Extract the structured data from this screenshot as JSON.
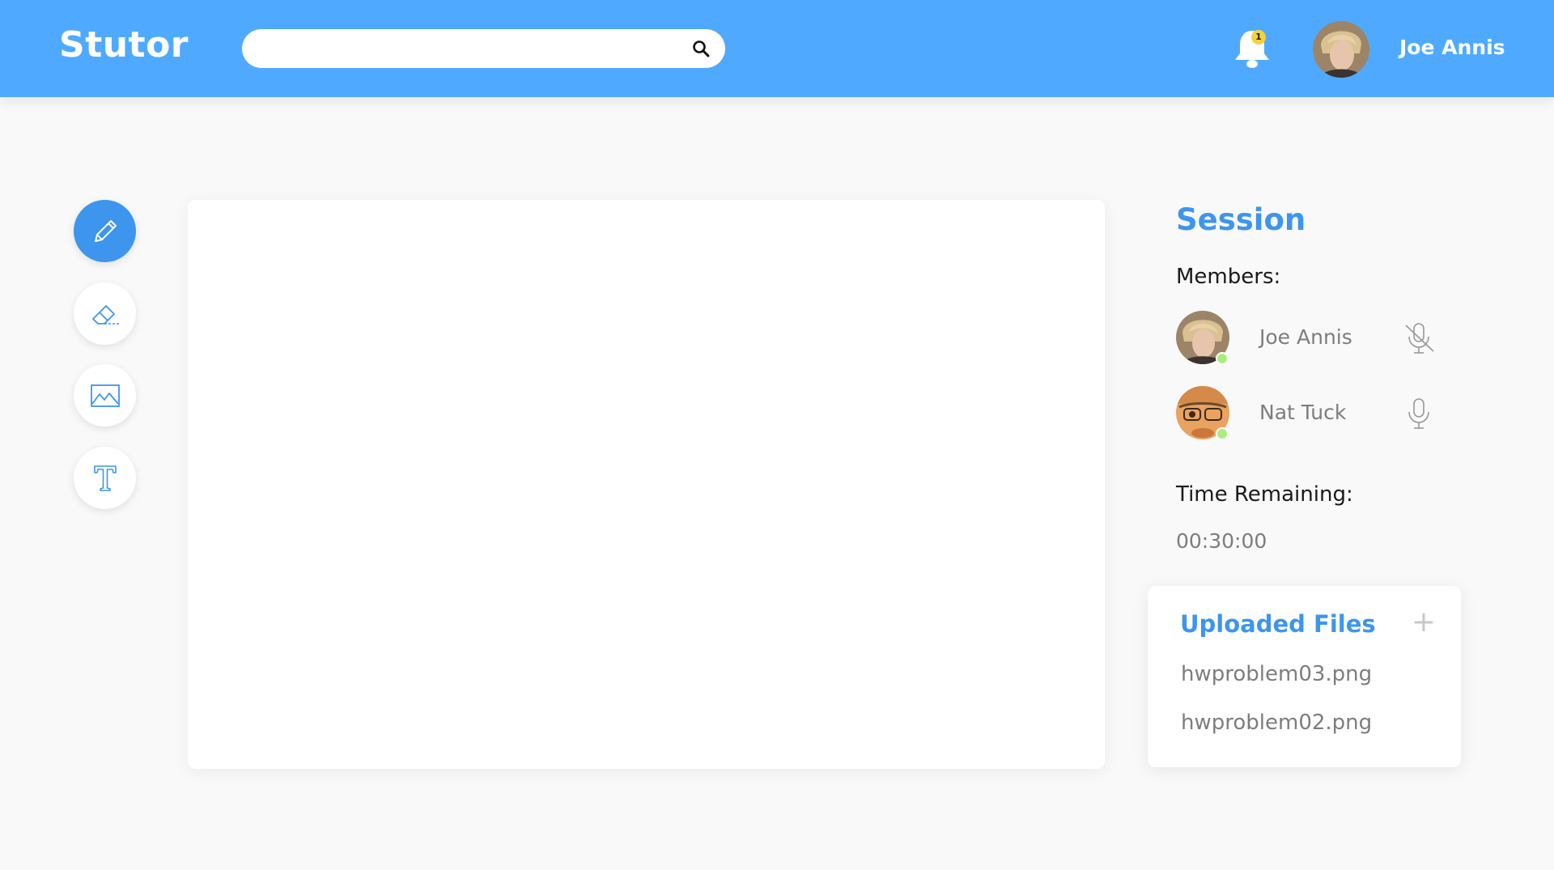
{
  "app": {
    "title": "Stutor"
  },
  "search": {
    "placeholder": "",
    "value": ""
  },
  "notifications": {
    "count": "1"
  },
  "user": {
    "name": "Joe Annis"
  },
  "tools": [
    {
      "name": "pencil",
      "active": true
    },
    {
      "name": "eraser",
      "active": false
    },
    {
      "name": "image",
      "active": false
    },
    {
      "name": "text",
      "active": false
    }
  ],
  "session": {
    "title": "Session",
    "members_label": "Members:",
    "members": [
      {
        "name": "Joe Annis",
        "mic": "muted",
        "status": "online"
      },
      {
        "name": "Nat Tuck",
        "mic": "on",
        "status": "online"
      }
    ],
    "time_label": "Time Remaining:",
    "time_value": "00:30:00"
  },
  "files": {
    "title": "Uploaded Files",
    "add_label": "+",
    "items": [
      "hwproblem03.png",
      "hwproblem02.png"
    ]
  },
  "colors": {
    "header": "#4faaff",
    "accent": "#3d95ee",
    "online": "#a9ed80",
    "badge": "#f3d23c"
  }
}
